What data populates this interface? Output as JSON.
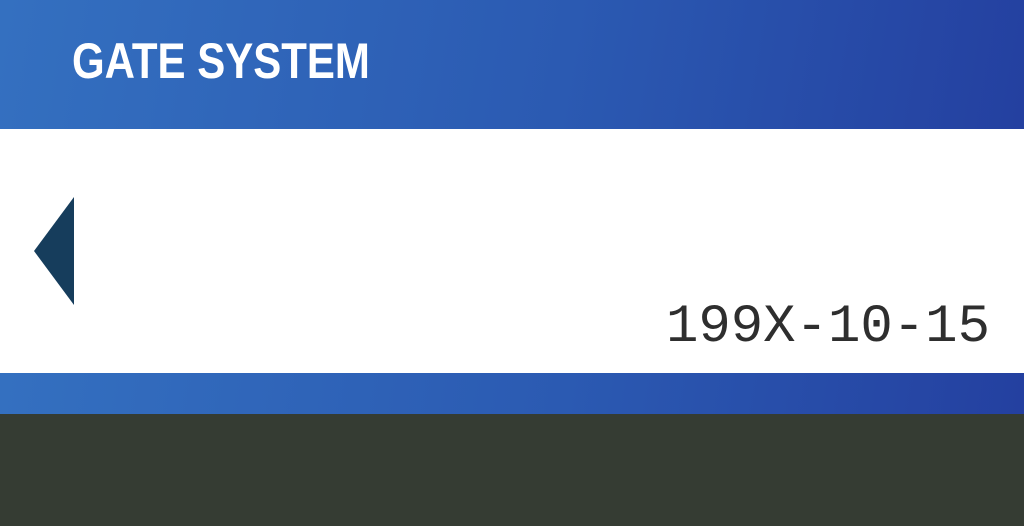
{
  "header": {
    "title": "GATE SYSTEM"
  },
  "content": {
    "date": "199X-10-15"
  },
  "colors": {
    "accent_blue": "#2b5ab2",
    "arrow": "#163d5c",
    "background_dark": "#353c33",
    "panel": "#ffffff"
  },
  "icons": {
    "back": "triangle-left-icon"
  }
}
